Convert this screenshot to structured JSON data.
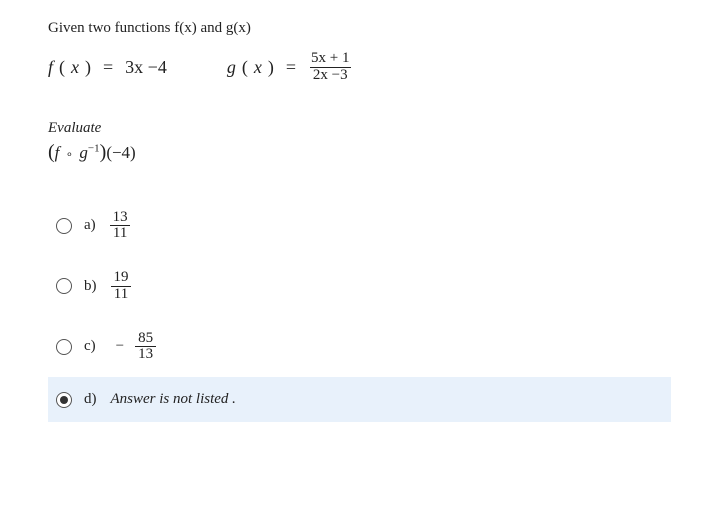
{
  "prompt": "Given  two functions f(x) and g(x)",
  "equations": {
    "f": {
      "lhs_fn": "f",
      "lhs_arg": "x",
      "rhs": "3x −4"
    },
    "g": {
      "lhs_fn": "g",
      "lhs_arg": "x",
      "numerator": "5x + 1",
      "denominator": "2x −3"
    }
  },
  "evaluate_label": "Evaluate",
  "expression": {
    "outer_fn": "f",
    "compose": "∘",
    "inner_fn": "g",
    "inner_exp": "−1",
    "arg": "(−4)"
  },
  "choices": {
    "a": {
      "label": "a)",
      "num": "13",
      "den": "11",
      "selected": false
    },
    "b": {
      "label": "b)",
      "num": "19",
      "den": "11",
      "selected": false
    },
    "c": {
      "label": "c)",
      "sign": "−",
      "num": "85",
      "den": "13",
      "selected": false
    },
    "d": {
      "label": "d)",
      "text": "Answer is not listed .",
      "selected": true
    }
  }
}
